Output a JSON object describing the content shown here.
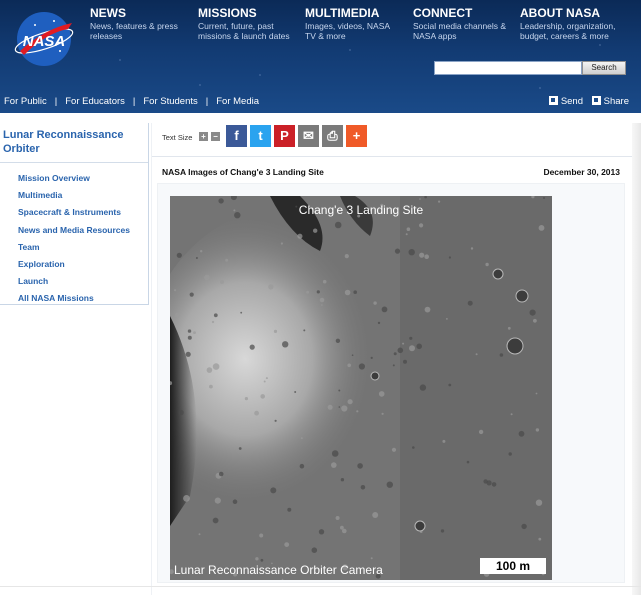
{
  "header": {
    "logo_text": "NASA",
    "nav": [
      {
        "title": "NEWS",
        "sub": "News, features & press releases"
      },
      {
        "title": "MISSIONS",
        "sub": "Current, future, past missions & launch dates"
      },
      {
        "title": "MULTIMEDIA",
        "sub": "Images, videos, NASA TV & more"
      },
      {
        "title": "CONNECT",
        "sub": "Social media channels & NASA apps"
      },
      {
        "title": "ABOUT NASA",
        "sub": "Leadership, organization, budget, careers & more"
      }
    ],
    "search_button": "Search",
    "search_placeholder": ""
  },
  "subnav": {
    "links": [
      "For Public",
      "For Educators",
      "For Students",
      "For Media"
    ],
    "send": "Send",
    "share": "Share"
  },
  "sidebar": {
    "title": "Lunar Reconnaissance Orbiter",
    "items": [
      "Mission Overview",
      "Multimedia",
      "Spacecraft & Instruments",
      "News and Media Resources",
      "Team",
      "Exploration",
      "Launch",
      "All NASA Missions"
    ]
  },
  "toolbar": {
    "text_size_label": "Text Size",
    "increase": "+",
    "decrease": "−",
    "share_buttons": [
      {
        "name": "facebook",
        "glyph": "f",
        "color": "#3b5998"
      },
      {
        "name": "twitter",
        "glyph": "t",
        "color": "#2aa3ef"
      },
      {
        "name": "pinterest",
        "glyph": "P",
        "color": "#cb2027"
      },
      {
        "name": "email",
        "glyph": "✉",
        "color": "#7a7a7a"
      },
      {
        "name": "print",
        "glyph": "⎙",
        "color": "#7a7a7a"
      },
      {
        "name": "more",
        "glyph": "+",
        "color": "#f05a28"
      }
    ]
  },
  "article": {
    "title": "NASA Images of Chang'e 3 Landing Site",
    "date": "December 30, 2013",
    "image_title": "Chang'e 3 Landing Site",
    "image_credit": "Lunar Reconnaissance Orbiter Camera",
    "scale_label": "100 m"
  },
  "colors": {
    "header_bg": "#123b73",
    "link_blue": "#2a64ad"
  }
}
